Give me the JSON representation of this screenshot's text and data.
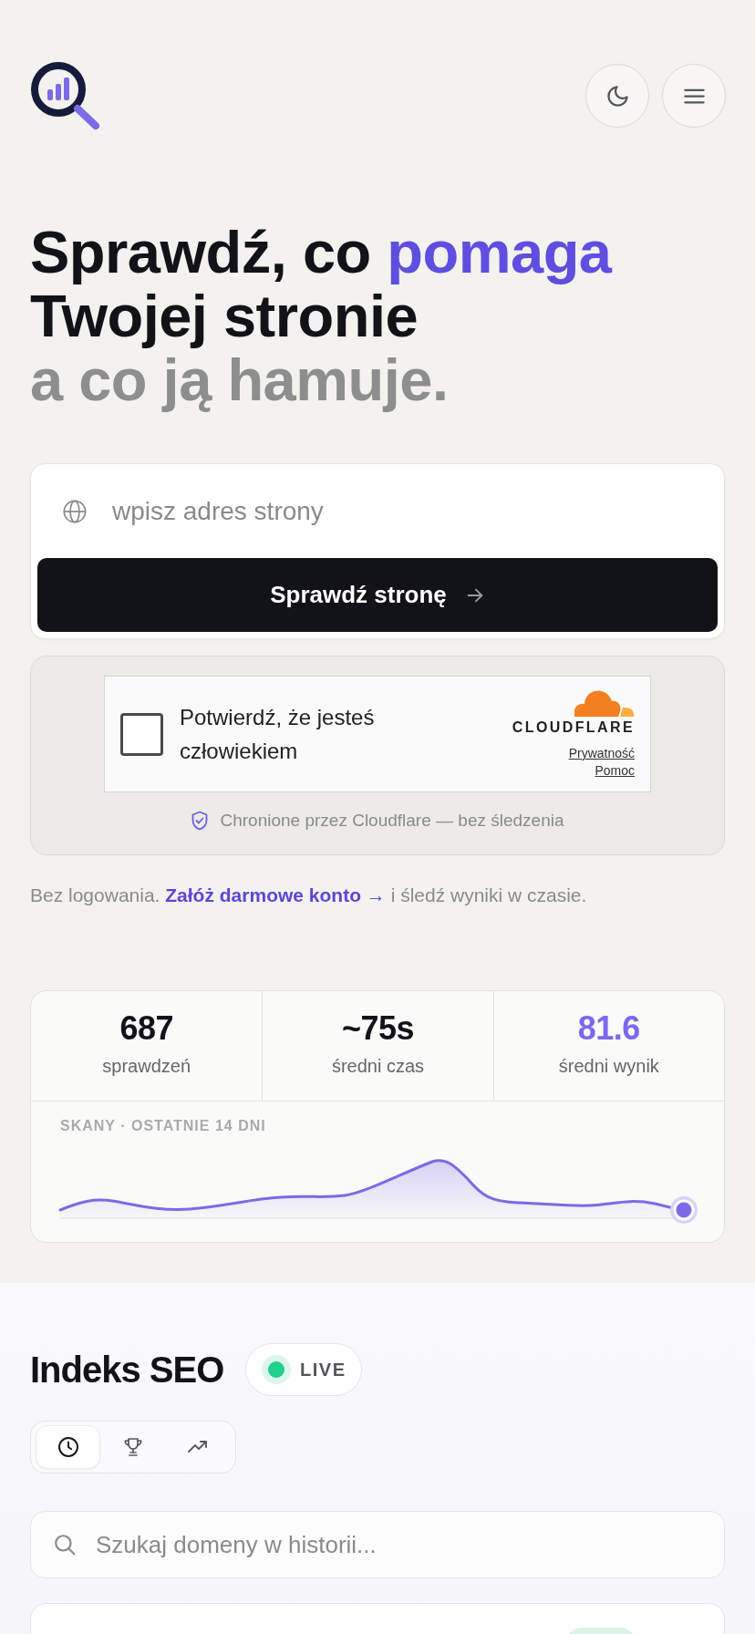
{
  "hero": {
    "headline": [
      [
        {
          "text": "Sprawdź, co",
          "kind": "strong"
        },
        {
          "text": "pomaga",
          "kind": "accent"
        }
      ],
      [
        {
          "text": "Twojej stronie",
          "kind": "strong"
        }
      ],
      [
        {
          "text": "a co ją hamuje.",
          "kind": "muted"
        }
      ]
    ]
  },
  "check_form": {
    "placeholder": "wpisz adres strony",
    "submit_label": "Sprawdź stronę"
  },
  "captcha": {
    "checked": false,
    "label": "Potwierdź, że jesteś człowiekiem",
    "brand": "CLOUDFLARE",
    "links": [
      "Prywatność",
      "Pomoc"
    ],
    "note": "Chronione przez Cloudflare — bez śledzenia"
  },
  "signup": {
    "before": "Bez logowania.",
    "link": "Załóż darmowe konto →",
    "after": "i śledź wyniki w czasie."
  },
  "stats": [
    {
      "value": "687",
      "label": "sprawdzeń",
      "highlighted": false
    },
    {
      "value": "~75s",
      "label": "średni czas",
      "highlighted": false
    },
    {
      "value": "81.6",
      "label": "średni wynik",
      "highlighted": true
    }
  ],
  "scans": {
    "label": "SKANY · OSTATNIE 14 DNI"
  },
  "seo_index": {
    "title": "Indeks SEO",
    "badge": "LIVE",
    "tabs": [
      {
        "kind": "recent",
        "selected": true
      },
      {
        "kind": "top",
        "selected": false
      },
      {
        "kind": "trending",
        "selected": false
      }
    ],
    "search_placeholder": "Szukaj domeny w historii..."
  }
}
